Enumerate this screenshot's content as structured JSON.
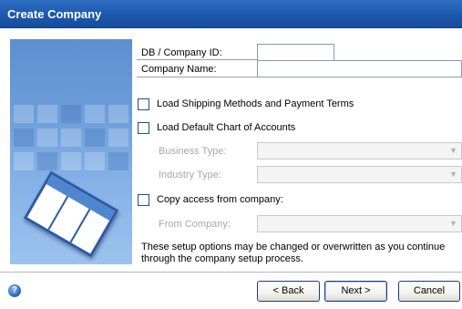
{
  "window": {
    "title": "Create Company"
  },
  "fields": {
    "db_company_id": {
      "label": "DB / Company ID:",
      "value": ""
    },
    "company_name": {
      "label": "Company Name:",
      "value": ""
    }
  },
  "options": {
    "load_shipping": {
      "label": "Load Shipping Methods and Payment Terms",
      "checked": false
    },
    "load_chart": {
      "label": "Load Default Chart of Accounts",
      "checked": false
    },
    "business_type": {
      "label": "Business Type:",
      "value": "",
      "enabled": false
    },
    "industry_type": {
      "label": "Industry Type:",
      "value": "",
      "enabled": false
    },
    "copy_access": {
      "label": "Copy access from company:",
      "checked": false
    },
    "from_company": {
      "label": "From Company:",
      "value": "",
      "enabled": false
    }
  },
  "info_text": "These setup options may be changed or overwritten as you continue through the company setup process.",
  "buttons": {
    "back": "< Back",
    "next": "Next >",
    "cancel": "Cancel"
  },
  "icons": {
    "help": "help-icon",
    "combo_arrow": "chevron-down-icon",
    "illustration": "document-illustration"
  },
  "colors": {
    "title_bar": "#1d58ad",
    "panel": "#6e9fdb"
  }
}
